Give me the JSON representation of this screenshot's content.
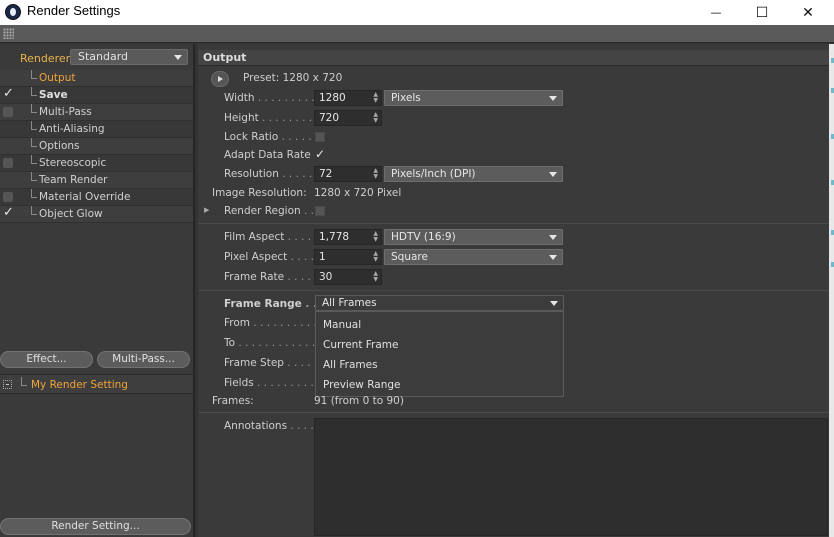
{
  "window": {
    "title": "Render Settings",
    "minimize_glyph": "—",
    "maximize_glyph": "☐",
    "close_glyph": "✕"
  },
  "left": {
    "renderer_label": "Renderer",
    "renderer_value": "Standard",
    "tree": [
      {
        "label": "Output",
        "checkbox": "none",
        "active": true,
        "bold": false
      },
      {
        "label": "Save",
        "checkbox": "checked",
        "active": false,
        "bold": true
      },
      {
        "label": "Multi-Pass",
        "checkbox": "unchecked",
        "active": false,
        "bold": false
      },
      {
        "label": "Anti-Aliasing",
        "checkbox": "none",
        "active": false,
        "bold": false
      },
      {
        "label": "Options",
        "checkbox": "none",
        "active": false,
        "bold": false
      },
      {
        "label": "Stereoscopic",
        "checkbox": "unchecked",
        "active": false,
        "bold": false
      },
      {
        "label": "Team Render",
        "checkbox": "none",
        "active": false,
        "bold": false
      },
      {
        "label": "Material Override",
        "checkbox": "unchecked",
        "active": false,
        "bold": false
      },
      {
        "label": "Object Glow",
        "checkbox": "checked",
        "active": false,
        "bold": false
      }
    ],
    "effect_button": "Effect...",
    "multipass_button": "Multi-Pass...",
    "setting_name": "My Render Setting",
    "render_setting_button": "Render Setting..."
  },
  "output": {
    "header": "Output",
    "preset_label": "Preset: 1280 x 720",
    "width_label": "Width",
    "width_dots": " . . . . . . . . . ",
    "width_value": "1280",
    "width_unit": "Pixels",
    "height_label": "Height",
    "height_dots": " . . . . . . . . . ",
    "height_value": "720",
    "lock_ratio_label": "Lock Ratio",
    "lock_ratio_dots": " . . . . . ",
    "adapt_label": "Adapt Data Rate",
    "resolution_label": "Resolution",
    "resolution_dots": " . . . . . ",
    "resolution_value": "72",
    "resolution_unit": "Pixels/Inch (DPI)",
    "image_res_label": "Image Resolution:",
    "image_res_value": "1280 x 720 Pixel",
    "render_region_label": "Render Region",
    "render_region_dots": " . . ",
    "film_aspect_label": "Film Aspect",
    "film_aspect_dots": " . . . . ",
    "film_aspect_value": "1,778",
    "film_aspect_preset": "HDTV (16:9)",
    "pixel_aspect_label": "Pixel Aspect",
    "pixel_aspect_dots": " . . . . ",
    "pixel_aspect_value": "1",
    "pixel_aspect_preset": "Square",
    "frame_rate_label": "Frame Rate",
    "frame_rate_dots": " . . . . ",
    "frame_rate_value": "30",
    "frame_range_label": "Frame Range",
    "frame_range_dots": " . . ",
    "frame_range_value": "All Frames",
    "frame_range_options": [
      "Manual",
      "Current Frame",
      "All Frames",
      "Preview Range"
    ],
    "from_label": "From",
    "from_dots": " . . . . . . . . . . . ",
    "to_label": "To",
    "to_dots": " . . . . . . . . . . . . ",
    "frame_step_label": "Frame Step",
    "frame_step_dots": " . . . . ",
    "fields_label": "Fields",
    "fields_dots": " . . . . . . . . . . ",
    "frames_label": "Frames:",
    "frames_value": "91 (from 0 to 90)",
    "annotations_label": "Annotations",
    "annotations_dots": " . . . . "
  }
}
